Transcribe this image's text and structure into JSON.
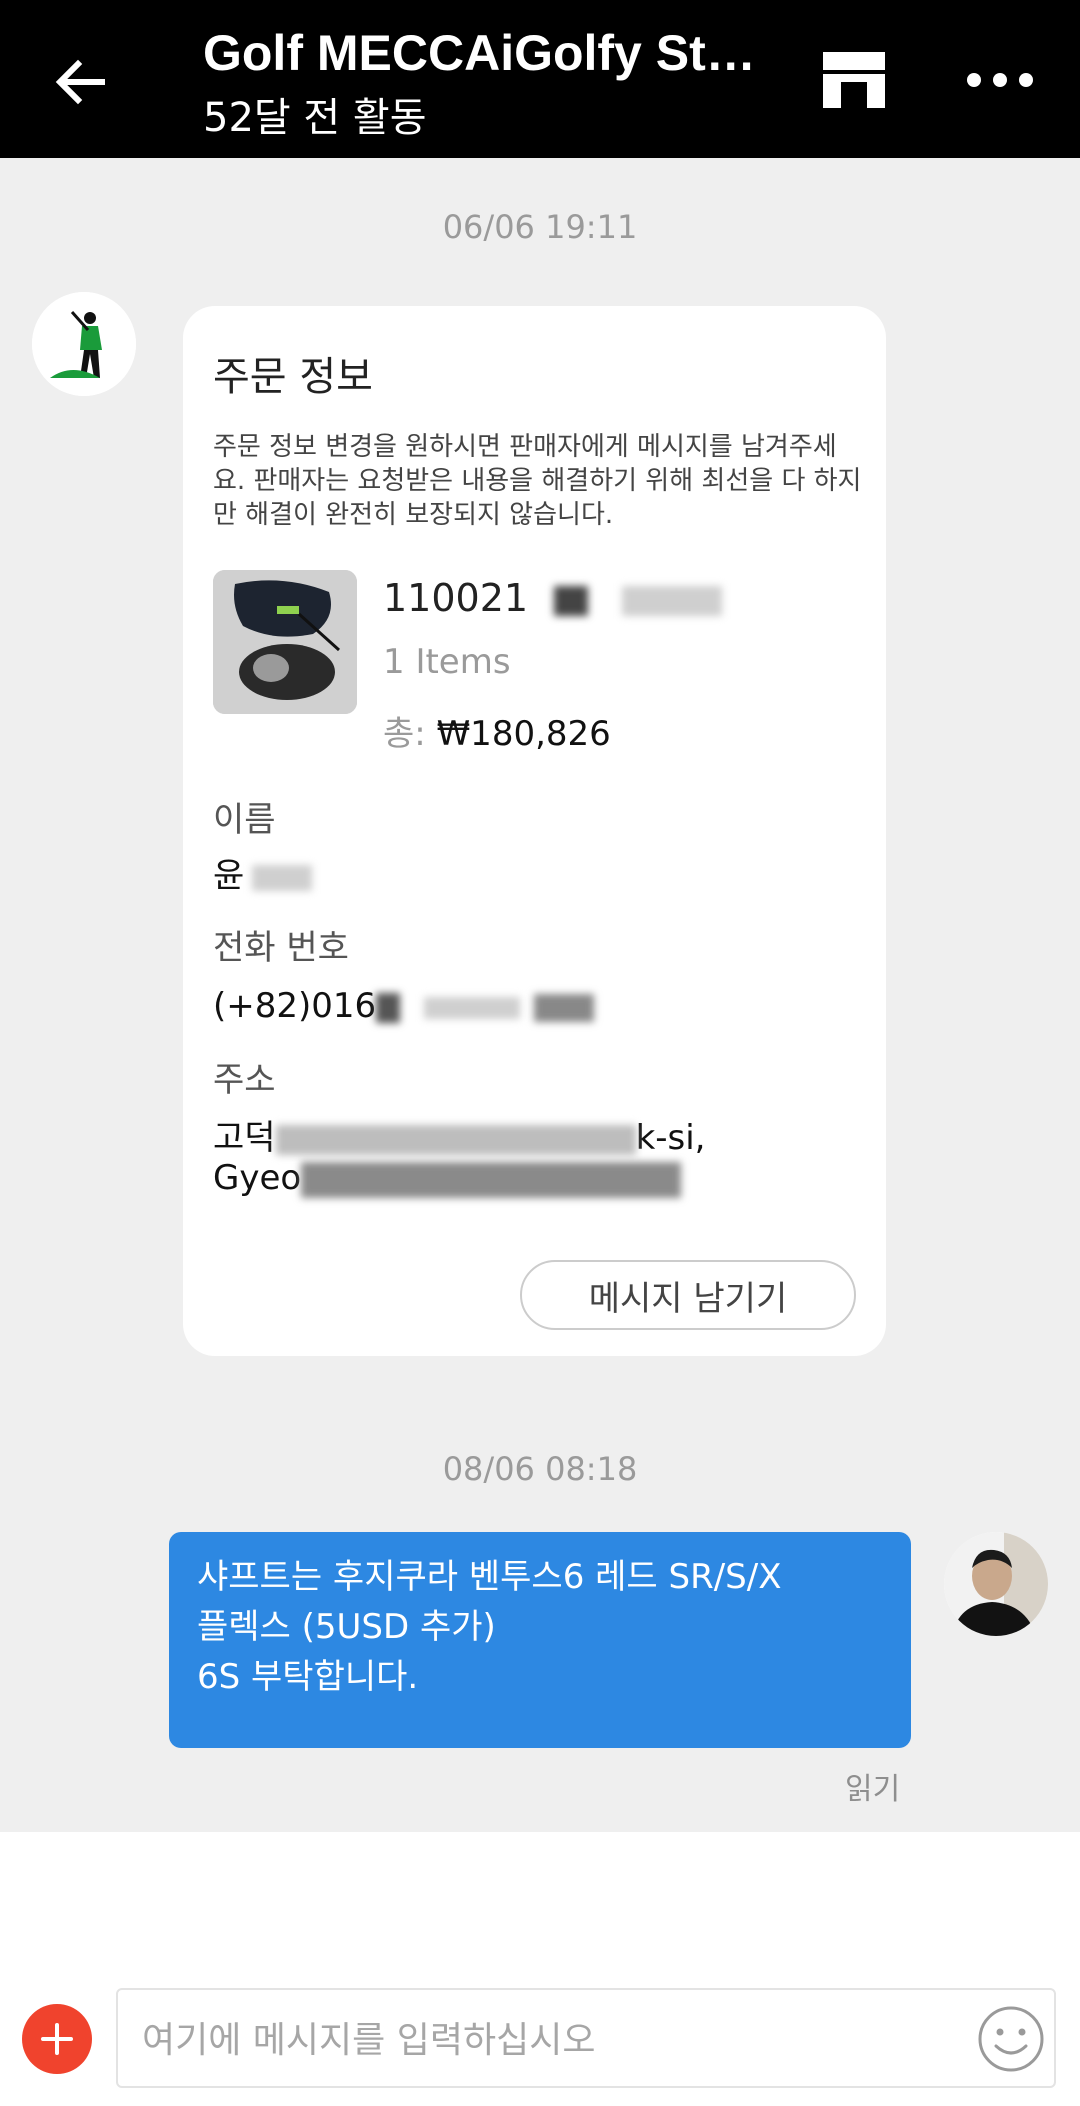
{
  "header": {
    "title": "Golf MECCAiGolfy Store",
    "subtitle": "52달 전 활동",
    "back_icon": "arrow-left-icon",
    "store_icon": "store-icon",
    "more_icon": "more-horizontal-icon"
  },
  "chat": {
    "timestamp_1": "06/06 19:11",
    "timestamp_2": "08/06 08:18",
    "order_card": {
      "title": "주문 정보",
      "note": "주문 정보 변경을 원하시면 판매자에게 메시지를 남겨주세요. 판매자는 요청받은 내용을 해결하기 위해 최선을 다 하지만 해결이 완전히 보장되지 않습니다.",
      "order_id": "110021",
      "items_count": "1 Items",
      "total_label": "총:",
      "total_value": "₩180,826",
      "name_label": "이름",
      "name_value": "윤",
      "phone_label": "전화 번호",
      "phone_value": "(+82)016",
      "address_label": "주소",
      "address_line1_start": "고덕",
      "address_line1_end": "k-si,",
      "address_line2_start": "Gyeo",
      "leave_message_button": "메시지 남기기"
    },
    "outgoing_message": {
      "lines": [
        "샤프트는 후지쿠라 벤투스6 레드 SR/S/X",
        "플렉스 (5USD 추가)",
        "6S 부탁합니다."
      ],
      "read_status": "읽기"
    }
  },
  "composer": {
    "placeholder": "여기에 메시지를 입력하십시오",
    "add_icon": "plus-icon",
    "emoji_icon": "smiley-icon"
  },
  "colors": {
    "header_bg": "#000000",
    "bubble_blue": "#2d88e2",
    "add_button_red": "#f0432d",
    "chat_bg": "#efefef"
  }
}
